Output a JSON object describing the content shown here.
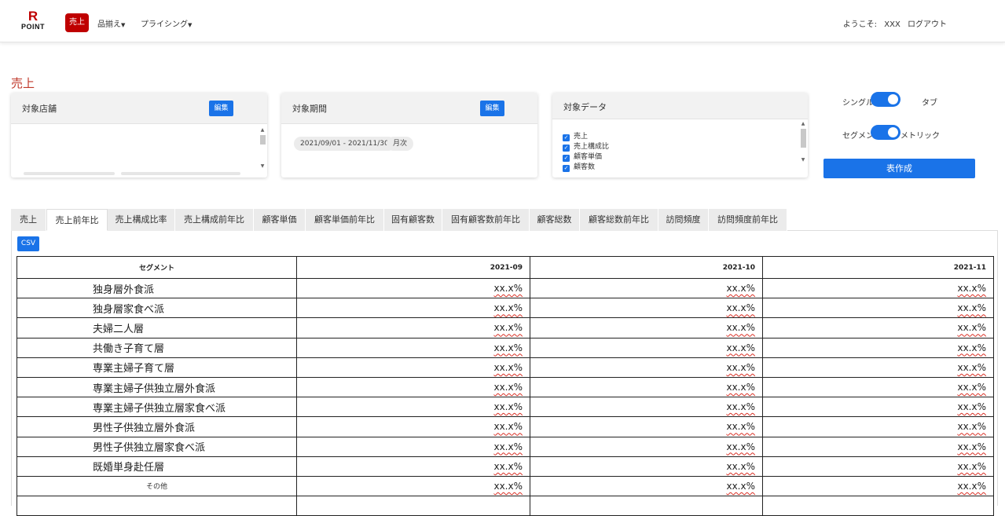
{
  "header": {
    "logo": {
      "letter": "R",
      "text": "POINT"
    },
    "nav": [
      {
        "label": "売上",
        "active": true
      },
      {
        "label": "品揃え",
        "dropdown": true
      },
      {
        "label": "プライシング",
        "dropdown": true
      }
    ],
    "user": {
      "welcome": "ようこそ:",
      "name": "XXX",
      "logout": "ログアウト"
    }
  },
  "page": {
    "title": "売上"
  },
  "filters": {
    "store": {
      "title": "対象店舗",
      "edit_label": "編集"
    },
    "period": {
      "title": "対象期間",
      "edit_label": "編集",
      "range_chip": "2021/09/01 - 2021/11/30",
      "unit_chip": "月次"
    },
    "data": {
      "title": "対象データ",
      "items": [
        {
          "label": "売上",
          "checked": true
        },
        {
          "label": "売上構成比",
          "checked": true
        },
        {
          "label": "顧客単価",
          "checked": true
        },
        {
          "label": "顧客数",
          "checked": true
        }
      ]
    }
  },
  "options": {
    "toggle1": {
      "left": "シングル",
      "right": "タブ",
      "on": true
    },
    "toggle2": {
      "left": "セグメン",
      "right": "メトリック",
      "on": true
    },
    "create_label": "表作成"
  },
  "tabs": [
    {
      "label": "売上"
    },
    {
      "label": "売上前年比",
      "active": true
    },
    {
      "label": "売上構成比率"
    },
    {
      "label": "売上構成前年比"
    },
    {
      "label": "顧客単価"
    },
    {
      "label": "顧客単価前年比"
    },
    {
      "label": "固有顧客数"
    },
    {
      "label": "固有顧客数前年比"
    },
    {
      "label": "顧客総数"
    },
    {
      "label": "顧客総数前年比"
    },
    {
      "label": "訪問頻度"
    },
    {
      "label": "訪問頻度前年比"
    }
  ],
  "csv_label": "CSV",
  "table": {
    "headers": [
      "セグメント",
      "2021-09",
      "2021-10",
      "2021-11"
    ],
    "rows": [
      {
        "segment": "独身層外食派",
        "values": [
          "xx.x%",
          "xx.x%",
          "xx.x%"
        ]
      },
      {
        "segment": "独身層家食べ派",
        "values": [
          "xx.x%",
          "xx.x%",
          "xx.x%"
        ]
      },
      {
        "segment": "夫婦二人層",
        "values": [
          "xx.x%",
          "xx.x%",
          "xx.x%"
        ]
      },
      {
        "segment": "共働き子育て層",
        "values": [
          "xx.x%",
          "xx.x%",
          "xx.x%"
        ]
      },
      {
        "segment": "専業主婦子育て層",
        "values": [
          "xx.x%",
          "xx.x%",
          "xx.x%"
        ]
      },
      {
        "segment": "専業主婦子供独立層外食派",
        "values": [
          "xx.x%",
          "xx.x%",
          "xx.x%"
        ]
      },
      {
        "segment": "専業主婦子供独立層家食べ派",
        "values": [
          "xx.x%",
          "xx.x%",
          "xx.x%"
        ]
      },
      {
        "segment": "男性子供独立層外食派",
        "values": [
          "xx.x%",
          "xx.x%",
          "xx.x%"
        ]
      },
      {
        "segment": "男性子供独立層家食べ派",
        "values": [
          "xx.x%",
          "xx.x%",
          "xx.x%"
        ]
      },
      {
        "segment": "既婚単身赴任層",
        "values": [
          "xx.x%",
          "xx.x%",
          "xx.x%"
        ]
      },
      {
        "segment": "その他",
        "values": [
          "xx.x%",
          "xx.x%",
          "xx.x%"
        ],
        "small": true
      },
      {
        "segment": "",
        "values": [
          "",
          "",
          ""
        ]
      }
    ]
  },
  "colors": {
    "brand_red": "#bf0000",
    "accent_blue": "#1a73e8",
    "title_red": "#c0392b"
  }
}
